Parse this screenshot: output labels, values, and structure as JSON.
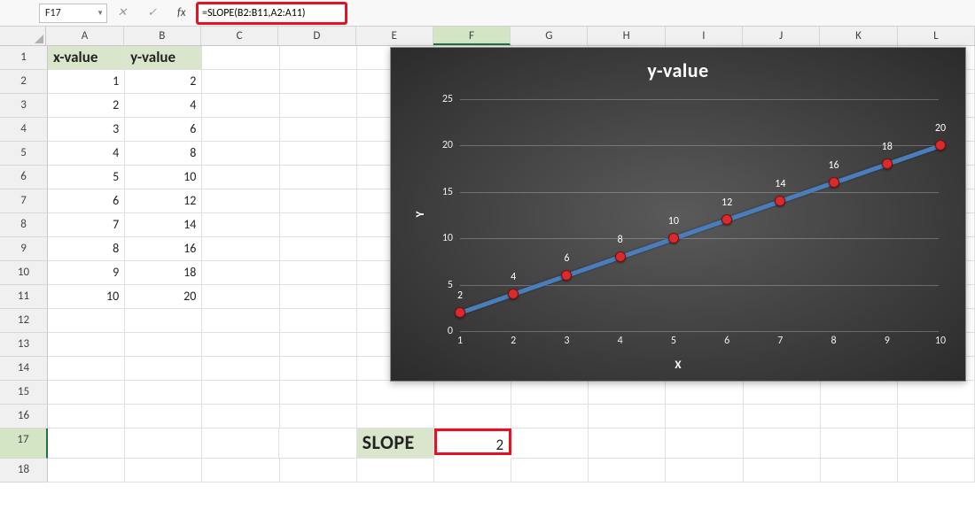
{
  "name_box": "F17",
  "formula": "=SLOPE(B2:B11,A2:A11)",
  "columns": [
    "A",
    "B",
    "C",
    "D",
    "E",
    "F",
    "G",
    "H",
    "I",
    "J",
    "K",
    "L"
  ],
  "row_count": 18,
  "headers": {
    "A1": "x-value",
    "B1": "y-value"
  },
  "table": {
    "x": [
      1,
      2,
      3,
      4,
      5,
      6,
      7,
      8,
      9,
      10
    ],
    "y": [
      2,
      4,
      6,
      8,
      10,
      12,
      14,
      16,
      18,
      20
    ]
  },
  "slope_label": "SLOPE",
  "slope_value": "2",
  "selected_cell": "F17",
  "chart_data": {
    "type": "line",
    "title": "y-value",
    "xlabel": "X",
    "ylabel": "Y",
    "categories": [
      1,
      2,
      3,
      4,
      5,
      6,
      7,
      8,
      9,
      10
    ],
    "values": [
      2,
      4,
      6,
      8,
      10,
      12,
      14,
      16,
      18,
      20
    ],
    "y_ticks": [
      0,
      5,
      10,
      15,
      20,
      25
    ],
    "ylim": [
      0,
      25
    ],
    "marker_color": "#d92b2b",
    "line_color": "#4a7ebb",
    "data_labels": true
  }
}
